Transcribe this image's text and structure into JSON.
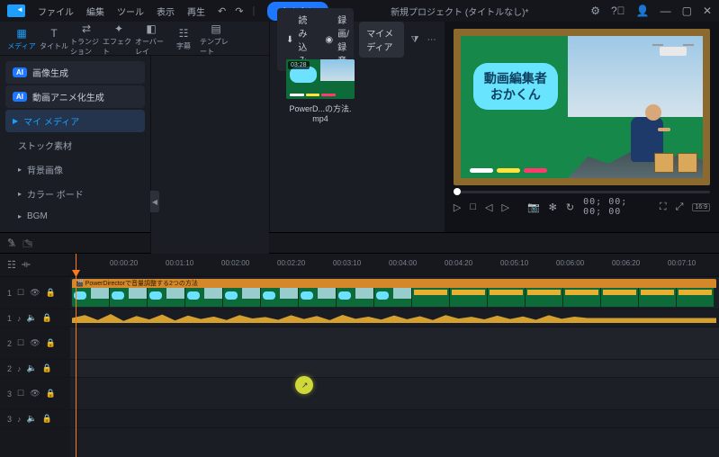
{
  "menu": {
    "file": "ファイル",
    "edit": "編集",
    "tool": "ツール",
    "view": "表示",
    "play": "再生"
  },
  "export_label": "書き出し",
  "title": "新規プロジェクト (タイトルなし)*",
  "tabs": {
    "media": "メディア",
    "title": "タイトル",
    "transition": "トランジション",
    "effect": "エフェクト",
    "overlay": "オーバーレイ",
    "subtitle": "字幕",
    "template": "テンプレート"
  },
  "sidebar": {
    "ai_image": "画像生成",
    "ai_video": "動画アニメ化生成",
    "my_media": "マイ メディア",
    "stock": "ストック素材",
    "background": "背景画像",
    "colorboard": "カラー ボード",
    "bgm": "BGM"
  },
  "media_bar": {
    "import": "読み込み",
    "record": "録画/録音",
    "dropdown": "マイメディア"
  },
  "clip": {
    "duration": "03:28",
    "filename": "PowerD...の方法.mp4",
    "timeline_title": "PowerDirectorで音量調整する2つの方法"
  },
  "preview": {
    "line1": "動画編集者",
    "line2": "おかくん"
  },
  "timecode": "00; 00; 00; 00",
  "aspect": "16:9",
  "ruler": [
    "00:00:20",
    "00:01:10",
    "00:02:00",
    "00:02:20",
    "00:03:10",
    "00:04:00",
    "00:04:20",
    "00:05:10",
    "00:06:00",
    "00:06:20",
    "00:07:10"
  ],
  "tracks": [
    "1",
    "1",
    "2",
    "2",
    "3",
    "3"
  ]
}
